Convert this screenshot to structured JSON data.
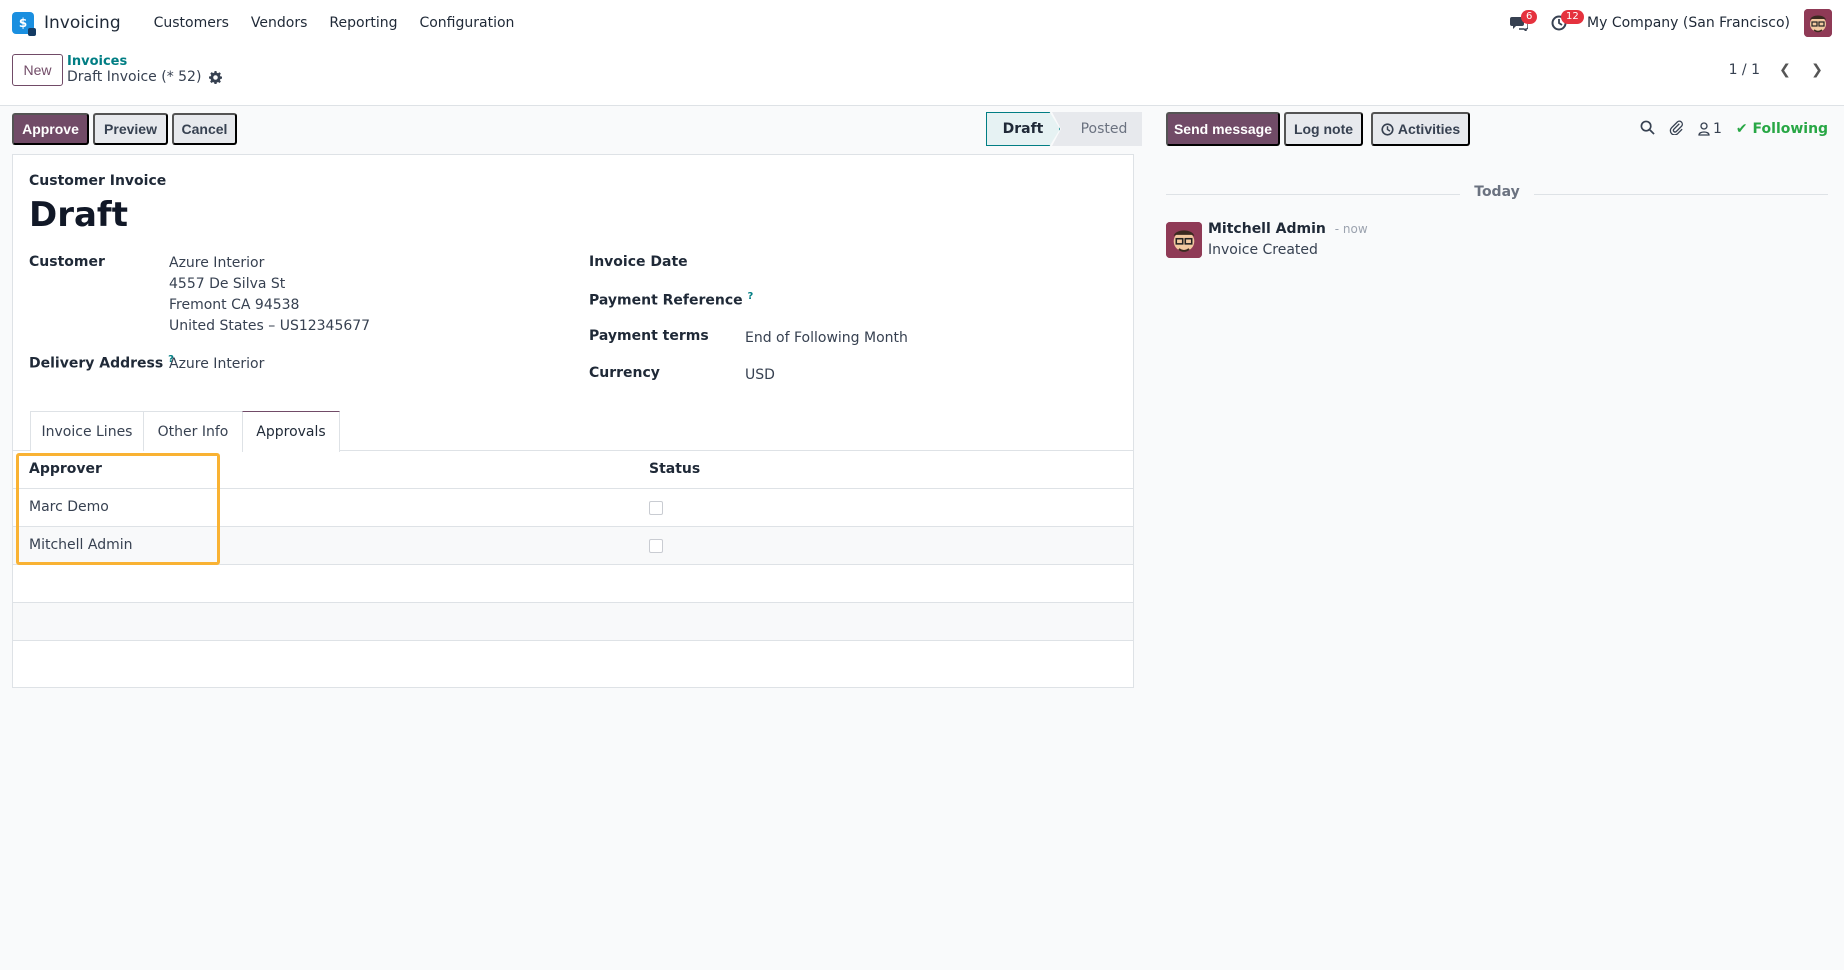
{
  "app": {
    "name": "Invoicing",
    "menu": [
      "Customers",
      "Vendors",
      "Reporting",
      "Configuration"
    ]
  },
  "systray": {
    "messages_count": "6",
    "activities_count": "12",
    "company": "My Company (San Francisco)"
  },
  "control_panel": {
    "new_label": "New",
    "breadcrumb_parent": "Invoices",
    "record_title": "Draft Invoice (* 52)",
    "pager_value": "1 / 1"
  },
  "actions": {
    "approve": "Approve",
    "preview": "Preview",
    "cancel": "Cancel"
  },
  "status": {
    "stages": [
      "Draft",
      "Posted"
    ],
    "current": "Draft"
  },
  "form": {
    "doc_type": "Customer Invoice",
    "title": "Draft",
    "customer_label": "Customer",
    "customer_lines": [
      "Azure Interior",
      "4557 De Silva St",
      "Fremont CA 94538",
      "United States – US12345677"
    ],
    "delivery_label": "Delivery Address",
    "delivery_value": "Azure Interior",
    "invoice_date_label": "Invoice Date",
    "payment_ref_label": "Payment Reference",
    "payment_terms_label": "Payment terms",
    "payment_terms_value": "End of Following Month",
    "currency_label": "Currency",
    "currency_value": "USD",
    "help_mark": "?"
  },
  "tabs": [
    "Invoice Lines",
    "Other Info",
    "Approvals"
  ],
  "approvals": {
    "columns": [
      "Approver",
      "Status"
    ],
    "rows": [
      {
        "approver": "Marc Demo",
        "approved": false
      },
      {
        "approver": "Mitchell Admin",
        "approved": false
      }
    ]
  },
  "chatter": {
    "send_message": "Send message",
    "log_note": "Log note",
    "activities": "Activities",
    "followers_count": "1",
    "following": "Following",
    "day_separator": "Today",
    "message": {
      "author": "Mitchell Admin",
      "time": "- now",
      "body": "Invoice Created"
    }
  },
  "colors": {
    "primary": "#714b67",
    "accent": "#017e84",
    "highlight": "#f9b233",
    "following": "#28a745"
  }
}
